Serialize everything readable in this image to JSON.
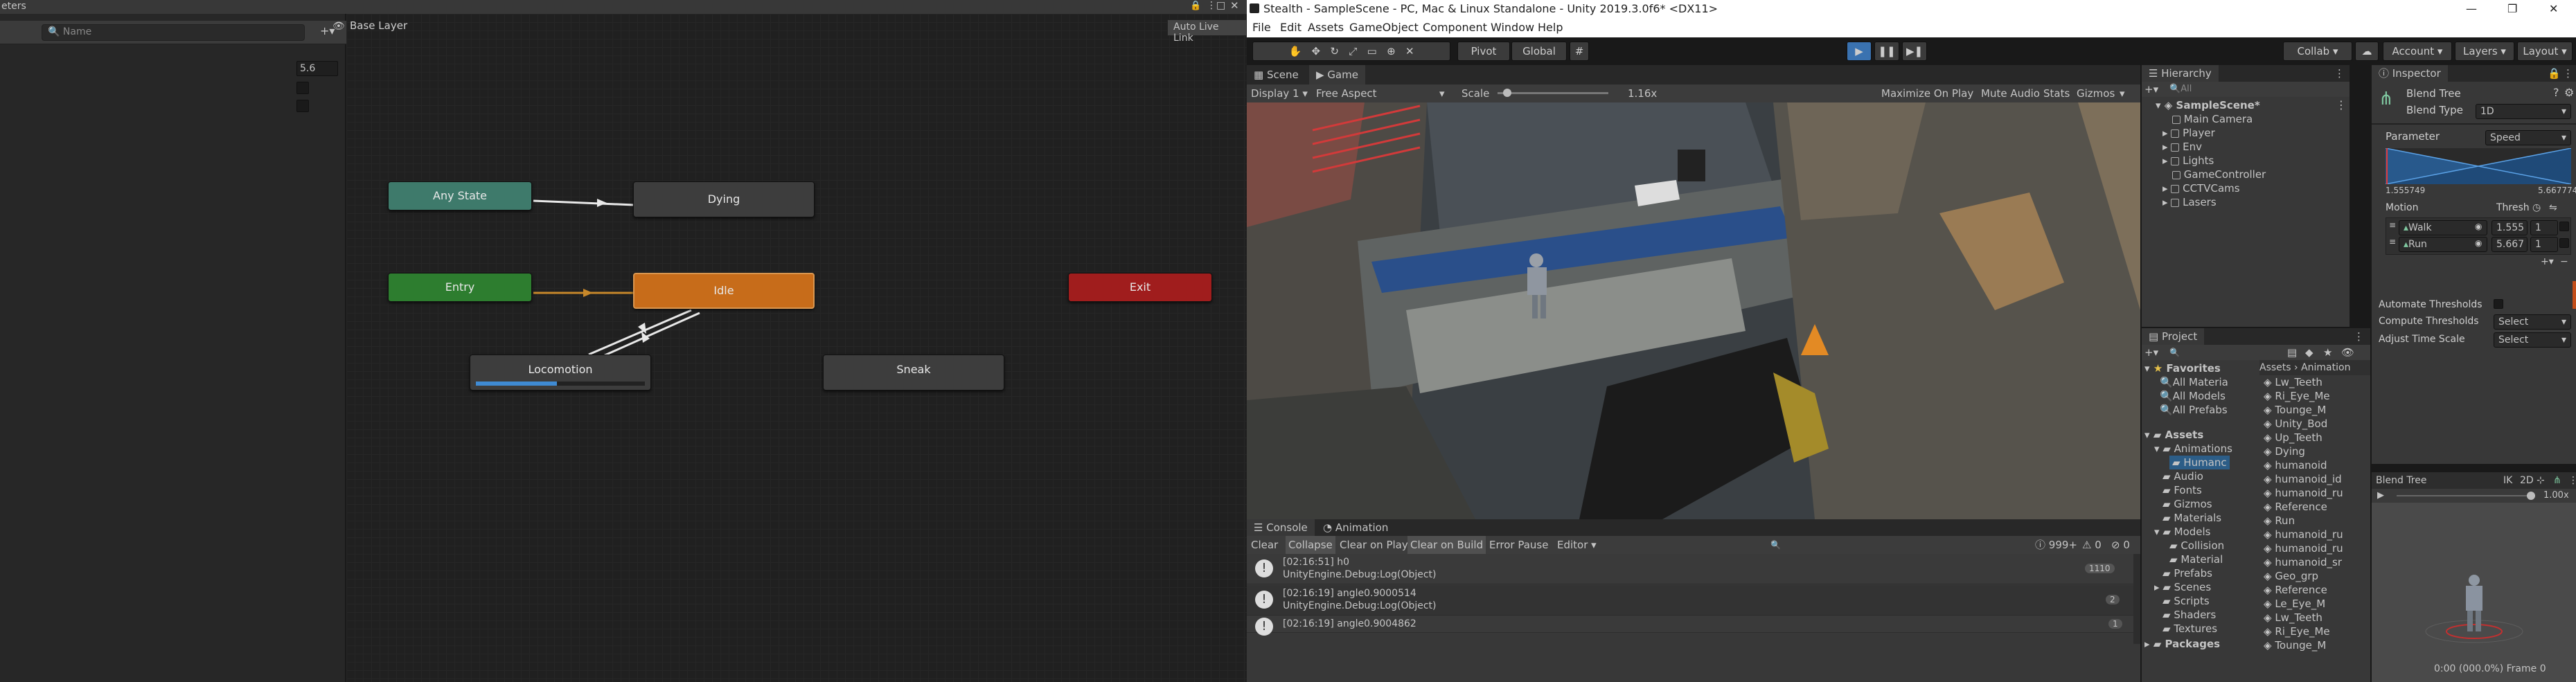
{
  "animator": {
    "params_tab": "eters",
    "search_placeholder": "Name",
    "params": [
      {
        "value": "5.6"
      },
      {
        "value": ""
      },
      {
        "value": ""
      }
    ],
    "breadcrumb": "Base Layer",
    "live_link": "Auto Live Link",
    "nodes": {
      "any": "Any State",
      "dying": "Dying",
      "entry": "Entry",
      "idle": "Idle",
      "exit": "Exit",
      "locomotion": "Locomotion",
      "sneak": "Sneak"
    },
    "locomotion_progress": 0.48
  },
  "window": {
    "title": "Stealth - SampleScene - PC, Mac & Linux Standalone - Unity 2019.3.0f6* <DX11>"
  },
  "menu": [
    "File",
    "Edit",
    "Assets",
    "GameObject",
    "Component",
    "Window",
    "Help"
  ],
  "toolbar": {
    "pivot": "Pivot",
    "global": "Global",
    "collab": "Collab",
    "account": "Account",
    "layers": "Layers",
    "layout": "Layout"
  },
  "scene": {
    "tabs": [
      "Scene",
      "Game"
    ],
    "display": "Display 1",
    "aspect": "Free Aspect",
    "scale_label": "Scale",
    "scale_value": "1.16x",
    "options": [
      "Maximize On Play",
      "Mute Audio",
      "Stats",
      "Gizmos"
    ]
  },
  "hierarchy": {
    "tab": "Hierarchy",
    "search": "All",
    "scene": "SampleScene*",
    "items": [
      "Main Camera",
      "Player",
      "Env",
      "Lights",
      "GameController",
      "CCTVCams",
      "Lasers"
    ]
  },
  "project": {
    "tab": "Project",
    "favorites_label": "Favorites",
    "favorites": [
      "All Materia",
      "All Models",
      "All Prefabs"
    ],
    "assets_label": "Assets",
    "tree": [
      "Animations",
      "Humanc",
      "Audio",
      "Fonts",
      "Gizmos",
      "Materials",
      "Models",
      "Collision",
      "Material",
      "Prefabs",
      "Scenes",
      "Scripts",
      "Shaders",
      "Textures"
    ],
    "packages": "Packages",
    "breadcrumb": [
      "Assets",
      "Animation"
    ],
    "files": [
      "Lw_Teeth",
      "Ri_Eye_Me",
      "Tounge_M",
      "Unity_Bod",
      "Up_Teeth",
      "Dying",
      "humanoid",
      "humanoid_id",
      "humanoid_ru",
      "Reference",
      "Run",
      "humanoid_ru",
      "humanoid_ru",
      "humanoid_sr",
      "Geo_grp",
      "Reference",
      "Le_Eye_M",
      "Lw_Teeth",
      "Ri_Eye_Me",
      "Tounge_M"
    ]
  },
  "console": {
    "tabs": [
      "Console",
      "Animation"
    ],
    "buttons": [
      "Clear",
      "Collapse",
      "Clear on Play",
      "Clear on Build",
      "Error Pause",
      "Editor"
    ],
    "count_log": "999+",
    "count_warn": "0",
    "count_err": "0",
    "rows": [
      {
        "line1": "[02:16:51] h0",
        "line2": "UnityEngine.Debug:Log(Object)",
        "count": "1110"
      },
      {
        "line1": "[02:16:19] angle0.9000514",
        "line2": "UnityEngine.Debug:Log(Object)",
        "count": "2"
      },
      {
        "line1": "[02:16:19] angle0.9004862",
        "line2": "",
        "count": "1"
      }
    ]
  },
  "inspector": {
    "tab": "Inspector",
    "name": "Blend Tree",
    "blend_type_label": "Blend Type",
    "blend_type": "1D",
    "parameter_label": "Parameter",
    "parameter": "Speed",
    "range_min": "1.555749",
    "range_max": "5.667774",
    "motion_label": "Motion",
    "thresh_label": "Thresh",
    "motions": [
      {
        "name": "Walk",
        "thresh": "1.555",
        "speed": "1"
      },
      {
        "name": "Run",
        "thresh": "5.667",
        "speed": "1"
      }
    ],
    "automate_label": "Automate Thresholds",
    "compute_label": "Compute Thresholds",
    "compute_value": "Select",
    "adjust_label": "Adjust Time Scale",
    "adjust_value": "Select",
    "preview_title": "Blend Tree",
    "preview_ik": "IK",
    "preview_2d": "2D",
    "preview_speed": "1.00x",
    "preview_time": "0:00 (000.0%) Frame 0"
  }
}
